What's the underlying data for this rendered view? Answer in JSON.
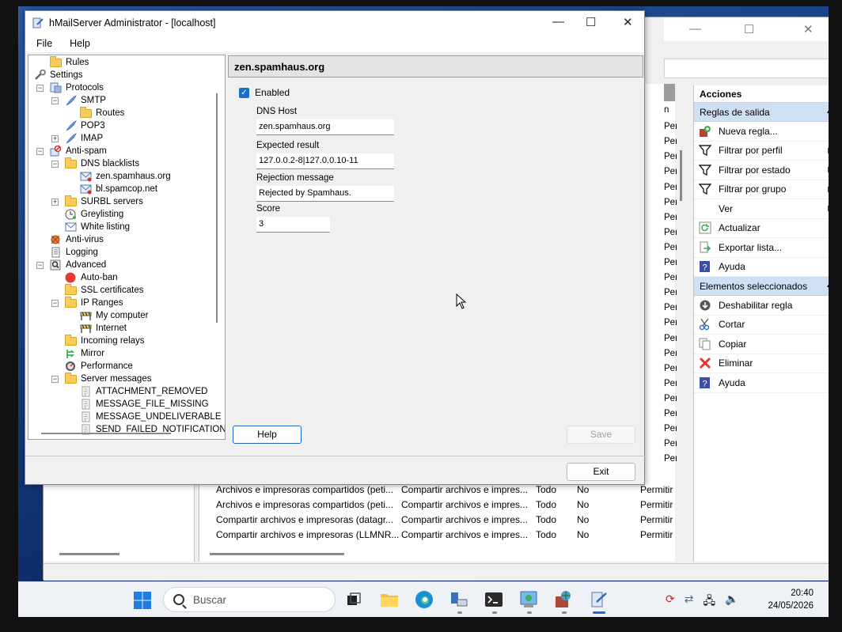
{
  "hmail": {
    "title": "hMailServer Administrator - [localhost]",
    "menu": [
      "File",
      "Help"
    ],
    "controls": {
      "minimize": "—",
      "maximize": "☐",
      "close": "✕"
    },
    "tree": [
      {
        "label": "Rules",
        "icon": "folder-icon",
        "level": 1,
        "expander": ""
      },
      {
        "label": "Settings",
        "icon": "settings-icon",
        "level": 0,
        "expander": "−"
      },
      {
        "label": "Protocols",
        "icon": "protocols-icon",
        "level": 1,
        "expander": "−"
      },
      {
        "label": "SMTP",
        "icon": "feather-icon",
        "level": 2,
        "expander": "−"
      },
      {
        "label": "Routes",
        "icon": "folder-icon",
        "level": 3,
        "expander": ""
      },
      {
        "label": "POP3",
        "icon": "feather-icon",
        "level": 2,
        "expander": ""
      },
      {
        "label": "IMAP",
        "icon": "feather-icon",
        "level": 2,
        "expander": "+"
      },
      {
        "label": "Anti-spam",
        "icon": "antispam-icon",
        "level": 1,
        "expander": "−"
      },
      {
        "label": "DNS blacklists",
        "icon": "folder-icon",
        "level": 2,
        "expander": "−"
      },
      {
        "label": "zen.spamhaus.org",
        "icon": "mail-icon",
        "level": 3,
        "expander": ""
      },
      {
        "label": "bl.spamcop.net",
        "icon": "mail-icon",
        "level": 3,
        "expander": ""
      },
      {
        "label": "SURBL servers",
        "icon": "folder-icon",
        "level": 2,
        "expander": "+"
      },
      {
        "label": "Greylisting",
        "icon": "clock-icon",
        "level": 2,
        "expander": ""
      },
      {
        "label": "White listing",
        "icon": "whitelist-icon",
        "level": 2,
        "expander": ""
      },
      {
        "label": "Anti-virus",
        "icon": "antivirus-icon",
        "level": 1,
        "expander": ""
      },
      {
        "label": "Logging",
        "icon": "log-icon",
        "level": 1,
        "expander": ""
      },
      {
        "label": "Advanced",
        "icon": "magnifier-icon",
        "level": 1,
        "expander": "−"
      },
      {
        "label": "Auto-ban",
        "icon": "stop-icon",
        "level": 2,
        "expander": ""
      },
      {
        "label": "SSL certificates",
        "icon": "folder-icon",
        "level": 2,
        "expander": ""
      },
      {
        "label": "IP Ranges",
        "icon": "folder-icon",
        "level": 2,
        "expander": "−"
      },
      {
        "label": "My computer",
        "icon": "barrier-icon",
        "level": 3,
        "expander": ""
      },
      {
        "label": "Internet",
        "icon": "barrier-icon",
        "level": 3,
        "expander": ""
      },
      {
        "label": "Incoming relays",
        "icon": "folder-icon",
        "level": 2,
        "expander": ""
      },
      {
        "label": "Mirror",
        "icon": "mirror-icon",
        "level": 2,
        "expander": ""
      },
      {
        "label": "Performance",
        "icon": "performance-icon",
        "level": 2,
        "expander": ""
      },
      {
        "label": "Server messages",
        "icon": "folder-icon",
        "level": 2,
        "expander": "−"
      },
      {
        "label": "ATTACHMENT_REMOVED",
        "icon": "document-icon",
        "level": 3,
        "expander": ""
      },
      {
        "label": "MESSAGE_FILE_MISSING",
        "icon": "document-icon",
        "level": 3,
        "expander": ""
      },
      {
        "label": "MESSAGE_UNDELIVERABLE",
        "icon": "document-icon",
        "level": 3,
        "expander": ""
      },
      {
        "label": "SEND_FAILED_NOTIFICATION",
        "icon": "document-icon",
        "level": 3,
        "expander": ""
      }
    ],
    "pane": {
      "title": "zen.spamhaus.org",
      "enabled_label": "Enabled",
      "enabled": true,
      "dns_host_label": "DNS Host",
      "dns_host": "zen.spamhaus.org",
      "expected_label": "Expected result",
      "expected": "127.0.0.2-8|127.0.0.10-11",
      "rejection_label": "Rejection message",
      "rejection": "Rejected by Spamhaus.",
      "score_label": "Score",
      "score": "3"
    },
    "buttons": {
      "help": "Help",
      "save": "Save",
      "exit": "Exit"
    }
  },
  "background": {
    "permitir": [
      "n",
      "Permitir",
      "Permitir",
      "Permitir",
      "Permitir",
      "Permitir",
      "Permitir",
      "Permitir",
      "Permitir",
      "Permitir",
      "Permitir",
      "Permitir",
      "Permitir",
      "Permitir",
      "Permitir",
      "Permitir",
      "Permitir",
      "Permitir",
      "Permitir",
      "Permitir",
      "Permitir",
      "Permitir",
      "Permitir",
      "Permitir"
    ],
    "rows": [
      {
        "name": "Archivos e impresoras compartidos (peti...",
        "group": "Compartir archivos e impres...",
        "profile": "Todo",
        "enabled": "No",
        "action": "Permitir"
      },
      {
        "name": "Archivos e impresoras compartidos (peti...",
        "group": "Compartir archivos e impres...",
        "profile": "Todo",
        "enabled": "No",
        "action": "Permitir"
      },
      {
        "name": "Compartir archivos e impresoras (datagr...",
        "group": "Compartir archivos e impres...",
        "profile": "Todo",
        "enabled": "No",
        "action": "Permitir"
      },
      {
        "name": "Compartir archivos e impresoras (LLMNR...",
        "group": "Compartir archivos e impres...",
        "profile": "Todo",
        "enabled": "No",
        "action": "Permitir"
      }
    ],
    "acciones": {
      "header": "Acciones",
      "section1": "Reglas de salida",
      "items1": [
        {
          "label": "Nueva regla...",
          "icon": "new-rule-icon",
          "arrow": ""
        },
        {
          "label": "Filtrar por perfil",
          "icon": "filter-icon",
          "arrow": "▶"
        },
        {
          "label": "Filtrar por estado",
          "icon": "filter-icon",
          "arrow": "▶"
        },
        {
          "label": "Filtrar por grupo",
          "icon": "filter-icon",
          "arrow": "▶"
        },
        {
          "label": "Ver",
          "icon": "",
          "arrow": "▶"
        },
        {
          "label": "Actualizar",
          "icon": "refresh-icon",
          "arrow": ""
        },
        {
          "label": "Exportar lista...",
          "icon": "export-icon",
          "arrow": ""
        },
        {
          "label": "Ayuda",
          "icon": "help-icon",
          "arrow": ""
        }
      ],
      "section2": "Elementos seleccionados",
      "items2": [
        {
          "label": "Deshabilitar regla",
          "icon": "disable-icon",
          "arrow": ""
        },
        {
          "label": "Cortar",
          "icon": "scissors-icon",
          "arrow": ""
        },
        {
          "label": "Copiar",
          "icon": "copy-icon",
          "arrow": ""
        },
        {
          "label": "Eliminar",
          "icon": "delete-icon",
          "arrow": ""
        },
        {
          "label": "Ayuda",
          "icon": "help-icon",
          "arrow": ""
        }
      ]
    }
  },
  "taskbar": {
    "search_placeholder": "Buscar",
    "time": "20:40",
    "date": "24/05/2026"
  },
  "colors": {
    "accent": "#1a6fc9",
    "section_bg": "#cfe0f5",
    "desktop": "#2a5ca8"
  }
}
